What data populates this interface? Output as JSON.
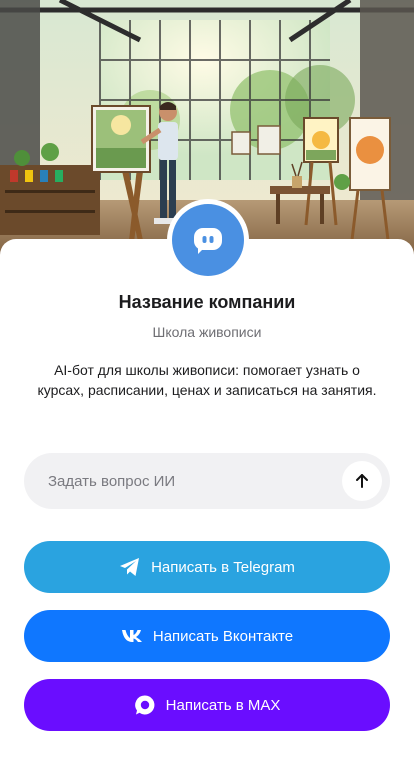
{
  "company": {
    "name": "Название компании",
    "category": "Школа живописи",
    "description": "AI-бот для школы живописи: помогает узнать о курсах, расписании, ценах и записаться на занятия."
  },
  "ask": {
    "placeholder": "Задать вопрос ИИ",
    "send_icon": "arrow-up-icon"
  },
  "actions": {
    "telegram": {
      "label": "Написать в Telegram",
      "icon": "telegram-icon",
      "color": "#2aa3e0"
    },
    "vk": {
      "label": "Написать Вконтакте",
      "icon": "vk-icon",
      "color": "#0f77ff"
    },
    "max": {
      "label": "Написать в MAX",
      "icon": "max-icon",
      "color": "#6a0dff"
    }
  },
  "colors": {
    "avatar": "#4a90e2",
    "card": "#ffffff"
  }
}
